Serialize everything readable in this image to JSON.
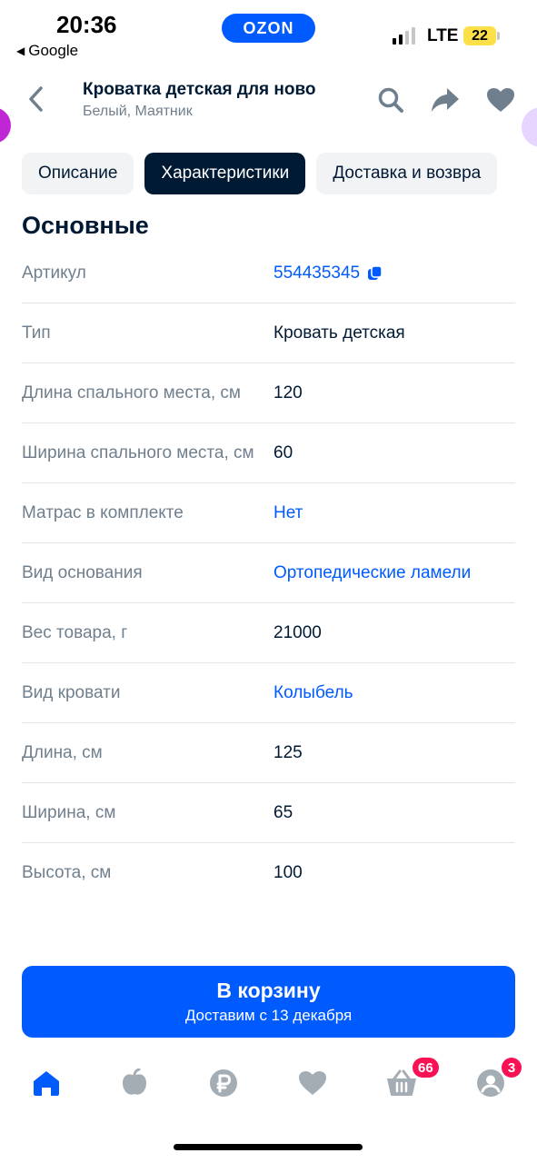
{
  "status_bar": {
    "time": "20:36",
    "back_app": "Google",
    "brand": "OZON",
    "network": "LTE",
    "battery": "22"
  },
  "header": {
    "title": "Кроватка детская для ново",
    "subtitle": "Белый, Маятник",
    "icons": [
      "back-icon",
      "search-icon",
      "share-icon",
      "heart-icon"
    ]
  },
  "tabs": [
    {
      "label": "Описание",
      "active": false
    },
    {
      "label": "Характеристики",
      "active": true
    },
    {
      "label": "Доставка и возвра",
      "active": false
    }
  ],
  "section": {
    "title": "Основные",
    "specs": [
      {
        "key": "Артикул",
        "value": "554435345",
        "link": true,
        "copy": true
      },
      {
        "key": "Тип",
        "value": "Кровать детская",
        "link": false
      },
      {
        "key": "Длина спального места, см",
        "value": "120",
        "link": false
      },
      {
        "key": "Ширина спального места, см",
        "value": "60",
        "link": false
      },
      {
        "key": "Матрас в комплекте",
        "value": "Нет",
        "link": true
      },
      {
        "key": "Вид основания",
        "value": "Ортопедические ламели",
        "link": true
      },
      {
        "key": "Вес товара, г",
        "value": "21000",
        "link": false
      },
      {
        "key": "Вид кровати",
        "value": "Колыбель",
        "link": true
      },
      {
        "key": "Длина, см",
        "value": "125",
        "link": false
      },
      {
        "key": "Ширина, см",
        "value": "65",
        "link": false
      },
      {
        "key": "Высота, см",
        "value": "100",
        "link": false
      }
    ]
  },
  "cart_button": {
    "label": "В корзину",
    "delivery": "Доставим с 13 декабря"
  },
  "bottom_nav": {
    "items": [
      {
        "icon": "home-icon",
        "active": true
      },
      {
        "icon": "fresh-icon"
      },
      {
        "icon": "ruble-icon"
      },
      {
        "icon": "favorites-icon"
      },
      {
        "icon": "cart-icon",
        "badge": "66"
      },
      {
        "icon": "profile-icon",
        "badge": "3"
      }
    ]
  },
  "colors": {
    "brand_blue": "#005bff",
    "text_dark": "#001a34",
    "text_muted": "#707f8d",
    "badge_pink": "#f91155"
  }
}
